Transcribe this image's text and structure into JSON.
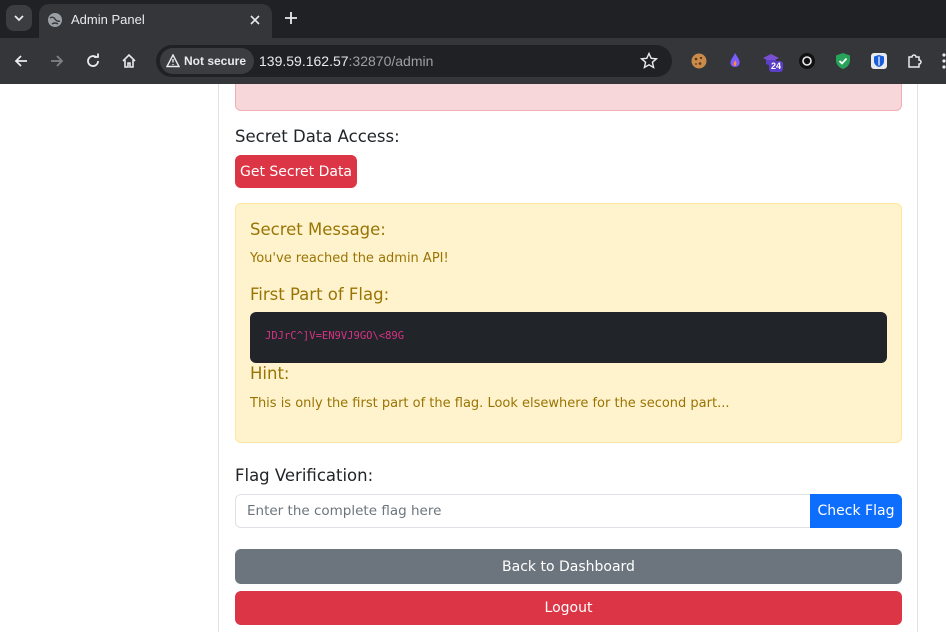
{
  "browser": {
    "tab": {
      "title": "Admin Panel"
    },
    "security": {
      "label": "Not secure"
    },
    "url": {
      "host": "139.59.162.57",
      "rest": ":32870/admin"
    },
    "extensions": [
      {
        "icon": "cookie-icon"
      },
      {
        "icon": "flame-drop-icon"
      },
      {
        "icon": "graduation-cap-icon",
        "badge": "24"
      },
      {
        "icon": "swirl-icon"
      },
      {
        "icon": "shield-check-icon"
      },
      {
        "icon": "bitwarden-shield-icon"
      },
      {
        "icon": "puzzle-icon"
      }
    ]
  },
  "page": {
    "secret_access": {
      "heading": "Secret Data Access:",
      "button_label": "Get Secret Data"
    },
    "secret_box": {
      "message_heading": "Secret Message:",
      "message_text": "You've reached the admin API!",
      "flag_heading": "First Part of Flag:",
      "flag_value": "JDJrC^]V=EN9VJ9GO\\<89G",
      "hint_heading": "Hint:",
      "hint_text": "This is only the first part of the flag. Look elsewhere for the second part..."
    },
    "verification": {
      "heading": "Flag Verification:",
      "input_placeholder": "Enter the complete flag here",
      "input_value": "",
      "check_label": "Check Flag"
    },
    "actions": {
      "back_label": "Back to Dashboard",
      "logout_label": "Logout"
    }
  },
  "colors": {
    "danger": "#dc3545",
    "primary": "#0d6efd",
    "secondary": "#6c757d",
    "warning_bg": "#fff3cd",
    "warning_text": "#997404",
    "code_bg": "#212529",
    "code_text": "#d63384"
  }
}
